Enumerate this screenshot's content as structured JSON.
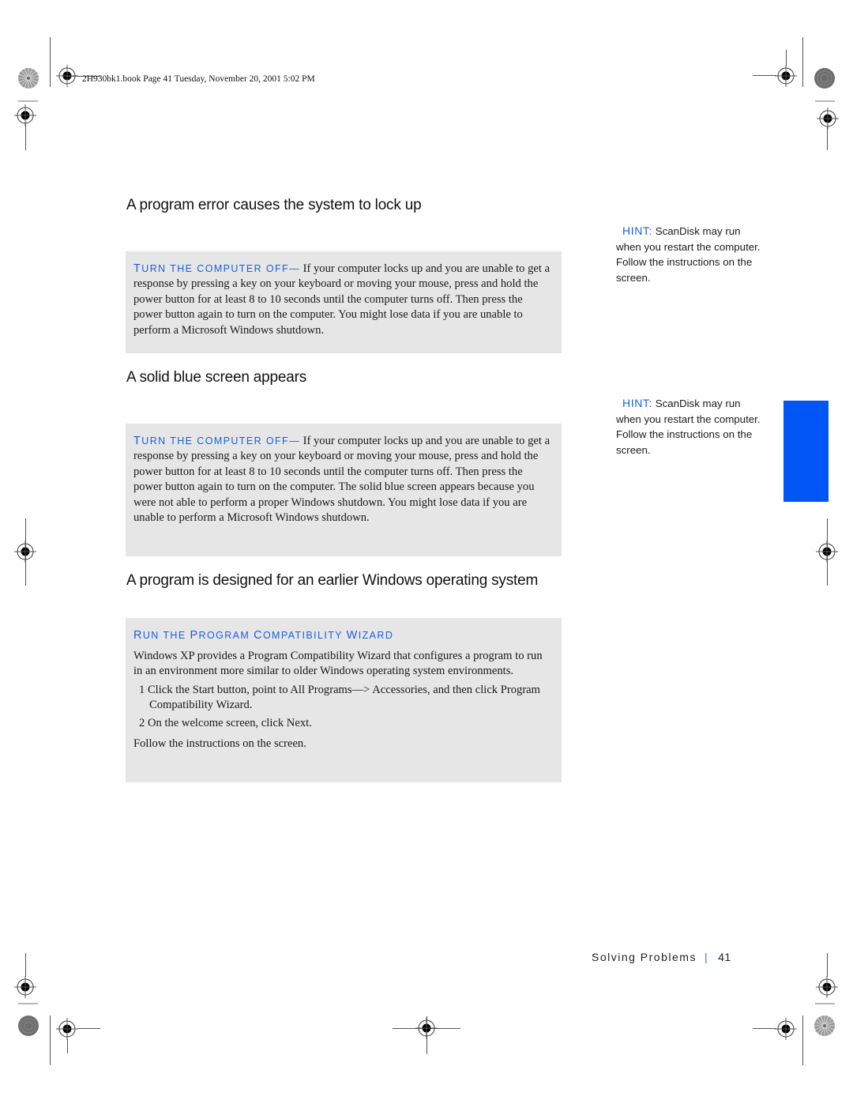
{
  "print_header": {
    "stamp": "2H930bk1.book  Page 41  Tuesday, November 20, 2001  5:02 PM"
  },
  "sections": [
    {
      "heading": "A program error causes the system to lock up",
      "box": {
        "label_first": "T",
        "label_rest": "URN THE COMPUTER OFF",
        "dash": "—",
        "body": " If your computer locks up and you are unable to get a response by pressing a key on your keyboard or moving your mouse, press and hold the power button for at least 8 to 10 seconds until the computer turns off. Then press the power button again to turn on the computer. You might lose data if you are unable to perform a Microsoft Windows shutdown."
      },
      "hint": {
        "label": "HINT:",
        "text": " ScanDisk may run when you restart the computer. Follow the instructions on the screen."
      }
    },
    {
      "heading": "A solid blue screen appears",
      "box": {
        "label_first": "T",
        "label_rest": "URN THE COMPUTER OFF",
        "dash": "—",
        "body": " If your computer locks up and you are unable to get a response by pressing a key on your keyboard or moving your mouse, press and hold the power button for at least 8 to 10 seconds until the computer turns off. Then press the power button again to turn on the computer. The solid blue screen appears because you were not able to perform a proper Windows shutdown. You might lose data if you are unable to perform a Microsoft Windows shutdown."
      },
      "hint": {
        "label": "HINT:",
        "text": " ScanDisk may run when you restart the computer. Follow the instructions on the screen."
      }
    },
    {
      "heading": "A program is designed for an earlier Windows operating system",
      "box": {
        "title_parts": [
          {
            "big": "R",
            "small": "UN THE "
          },
          {
            "big": "P",
            "small": "ROGRAM "
          },
          {
            "big": "C",
            "small": "OMPATIBILITY "
          },
          {
            "big": "W",
            "small": "IZARD"
          }
        ],
        "intro": "Windows XP provides a Program Compatibility Wizard that configures a program to run in an environment more similar to older Windows operating system environments.",
        "steps": [
          {
            "num": "1",
            "text": "Click the Start button, point to All Programs—>  Accessories, and then click Program Compatibility Wizard."
          },
          {
            "num": "2",
            "text": "On the welcome screen, click Next."
          }
        ],
        "closing": "Follow the instructions on the screen."
      }
    }
  ],
  "thumb_tab": {
    "color": "#0055f5"
  },
  "footer": {
    "chapter": "Solving Problems",
    "separator": "|",
    "page_number": "41"
  },
  "colors": {
    "accent_blue": "#1a5fe0",
    "box_background": "#e6e6e6"
  }
}
